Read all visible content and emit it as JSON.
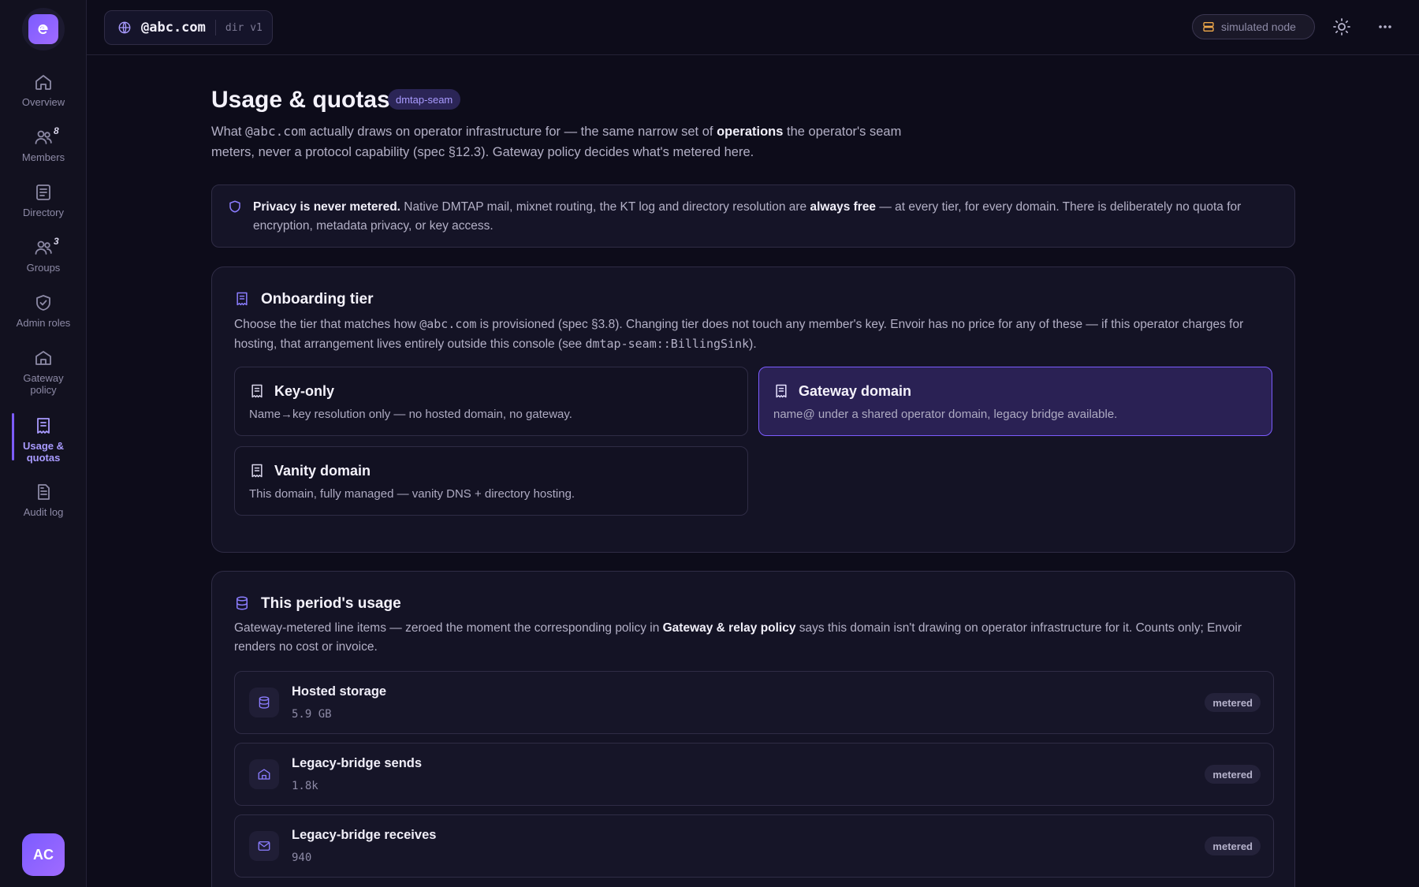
{
  "app": {
    "logo_label": "e"
  },
  "sidebar": {
    "items": [
      {
        "label": "Overview",
        "icon": "home-icon"
      },
      {
        "label": "Members",
        "icon": "users-icon",
        "badge": "8"
      },
      {
        "label": "Directory",
        "icon": "list-icon"
      },
      {
        "label": "Groups",
        "icon": "users-icon",
        "badge": "3"
      },
      {
        "label": "Admin roles",
        "icon": "shield-check-icon"
      },
      {
        "label": "Gateway policy",
        "icon": "gateway-icon"
      },
      {
        "label": "Usage & quotas",
        "icon": "receipt-icon",
        "active": true
      },
      {
        "label": "Audit log",
        "icon": "file-text-icon"
      }
    ],
    "avatar_initials": "AC"
  },
  "topbar": {
    "domain": "@abc.com",
    "version": "dir v1",
    "node_status": "simulated node"
  },
  "page": {
    "title": "Usage & quotas",
    "tag": "dmtap-seam",
    "intro": {
      "p1": "What ",
      "domain": "@abc.com",
      "p2": " actually draws on operator infrastructure for — the same narrow set of ",
      "bold": "operations",
      "p3": " the operator's seam meters, never a protocol capability (spec §12.3). Gateway policy decides what's metered here."
    },
    "privacy": {
      "bold1": "Privacy is never metered.",
      "p1": " Native DMTAP mail, mixnet routing, the KT log and directory resolution are ",
      "bold2": "always free",
      "p2": " — at every tier, for every domain. There is deliberately no quota for encryption, metadata privacy, or key access."
    }
  },
  "onboarding": {
    "title": "Onboarding tier",
    "desc": {
      "p1": "Choose the tier that matches how ",
      "domain": "@abc.com",
      "p2": " is provisioned (spec §3.8). Changing tier does not touch any member's key. Envoir has no price for any of these — if this operator charges for hosting, that arrangement lives entirely outside this console (see ",
      "code": "dmtap-seam::BillingSink",
      "p3": ")."
    },
    "tiers": [
      {
        "name": "Key-only",
        "desc": "Name→key resolution only — no hosted domain, no gateway.",
        "selected": false
      },
      {
        "name": "Gateway domain",
        "desc": "name@ under a shared operator domain, legacy bridge available.",
        "selected": true
      },
      {
        "name": "Vanity domain",
        "desc": "This domain, fully managed — vanity DNS + directory hosting.",
        "selected": false
      }
    ]
  },
  "usage": {
    "title": "This period's usage",
    "desc": {
      "p1": "Gateway-metered line items — zeroed the moment the corresponding policy in ",
      "bold": "Gateway & relay policy",
      "p2": " says this domain isn't drawing on operator infrastructure for it. Counts only; Envoir renders no cost or invoice."
    },
    "items": [
      {
        "name": "Hosted storage",
        "value": "5.9 GB",
        "badge": "metered",
        "icon": "database-icon"
      },
      {
        "name": "Legacy-bridge sends",
        "value": "1.8k",
        "badge": "metered",
        "icon": "gateway-icon"
      },
      {
        "name": "Legacy-bridge receives",
        "value": "940",
        "badge": "metered",
        "icon": "mail-icon"
      }
    ]
  },
  "colors": {
    "accent": "#7c5cff",
    "background": "#0d0c1a",
    "surface": "#141325"
  }
}
